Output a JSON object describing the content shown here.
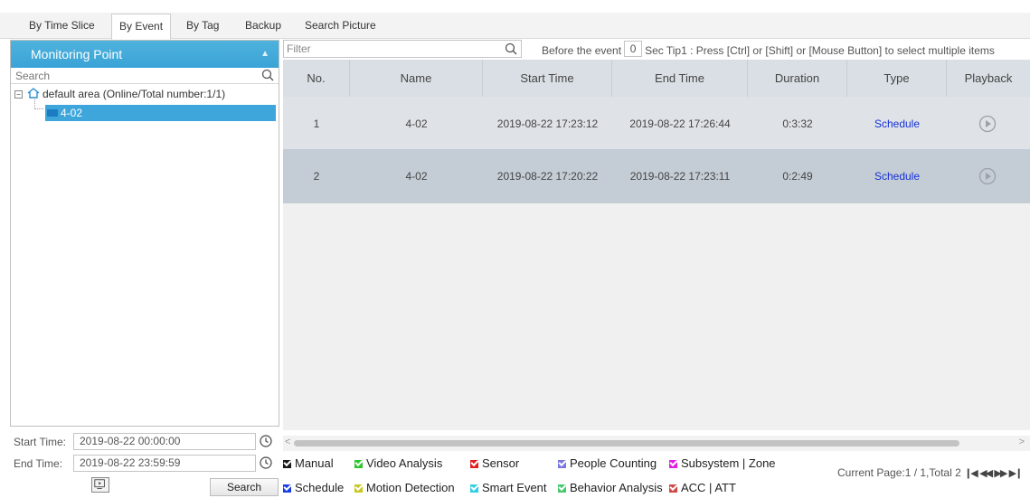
{
  "tabs": [
    {
      "label": "By Time Slice",
      "active": false
    },
    {
      "label": "By Event",
      "active": true
    },
    {
      "label": "By Tag",
      "active": false
    },
    {
      "label": "Backup",
      "active": false
    },
    {
      "label": "Search Picture",
      "active": false
    }
  ],
  "monitoring": {
    "title": "Monitoring Point",
    "search_placeholder": "Search",
    "root_label": "default area (Online/Total number:1/1)",
    "child_label": "4-02"
  },
  "time": {
    "start_label": "Start Time:",
    "start_value": "2019-08-22 00:00:00",
    "end_label": "End Time:",
    "end_value": "2019-08-22 23:59:59"
  },
  "search_button": "Search",
  "filter": {
    "placeholder": "Filter",
    "before_label": "Before the event",
    "before_value": "0",
    "tip": "Sec Tip1 : Press [Ctrl] or [Shift] or [Mouse Button] to select multiple items"
  },
  "table": {
    "headers": [
      "No.",
      "Name",
      "Start Time",
      "End Time",
      "Duration",
      "Type",
      "Playback"
    ],
    "rows": [
      {
        "no": "1",
        "name": "4-02",
        "start": "2019-08-22 17:23:12",
        "end": "2019-08-22 17:26:44",
        "duration": "0:3:32",
        "type": "Schedule"
      },
      {
        "no": "2",
        "name": "4-02",
        "start": "2019-08-22 17:20:22",
        "end": "2019-08-22 17:23:11",
        "duration": "0:2:49",
        "type": "Schedule"
      }
    ]
  },
  "legend": [
    {
      "label": "Manual",
      "color": "#1a1a1a"
    },
    {
      "label": "Video Analysis",
      "color": "#2fc52f"
    },
    {
      "label": "Sensor",
      "color": "#e02020"
    },
    {
      "label": "People Counting",
      "color": "#7b78e0"
    },
    {
      "label": "Subsystem | Zone",
      "color": "#e020e0"
    },
    {
      "label": "Schedule",
      "color": "#1a3fe0"
    },
    {
      "label": "Motion Detection",
      "color": "#c8c820"
    },
    {
      "label": "Smart Event",
      "color": "#30d0e0"
    },
    {
      "label": "Behavior Analysis",
      "color": "#48c870"
    },
    {
      "label": "ACC | ATT",
      "color": "#d04848"
    }
  ],
  "pager": {
    "text": "Current Page:1 / 1,Total 2"
  }
}
